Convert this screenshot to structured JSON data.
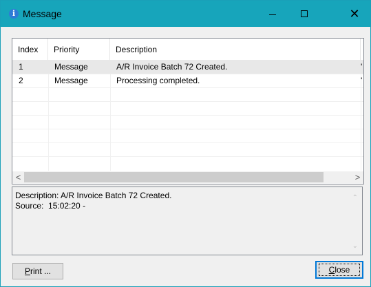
{
  "window": {
    "title": "Message",
    "info_icon": "info-icon"
  },
  "table": {
    "columns": [
      "Index",
      "Priority",
      "Description",
      "S"
    ],
    "rows": [
      {
        "index": "1",
        "priority": "Message",
        "description": "A/R Invoice Batch 72 Created.",
        "tail": "'"
      },
      {
        "index": "2",
        "priority": "Message",
        "description": "Processing completed.",
        "tail": "'"
      }
    ]
  },
  "details": {
    "line1": "Description: A/R Invoice Batch 72 Created.",
    "line2": "Source:  15:02:20 -"
  },
  "buttons": {
    "print_mnemonic": "P",
    "print_rest": "rint ...",
    "close_mnemonic": "C",
    "close_rest": "lose"
  }
}
